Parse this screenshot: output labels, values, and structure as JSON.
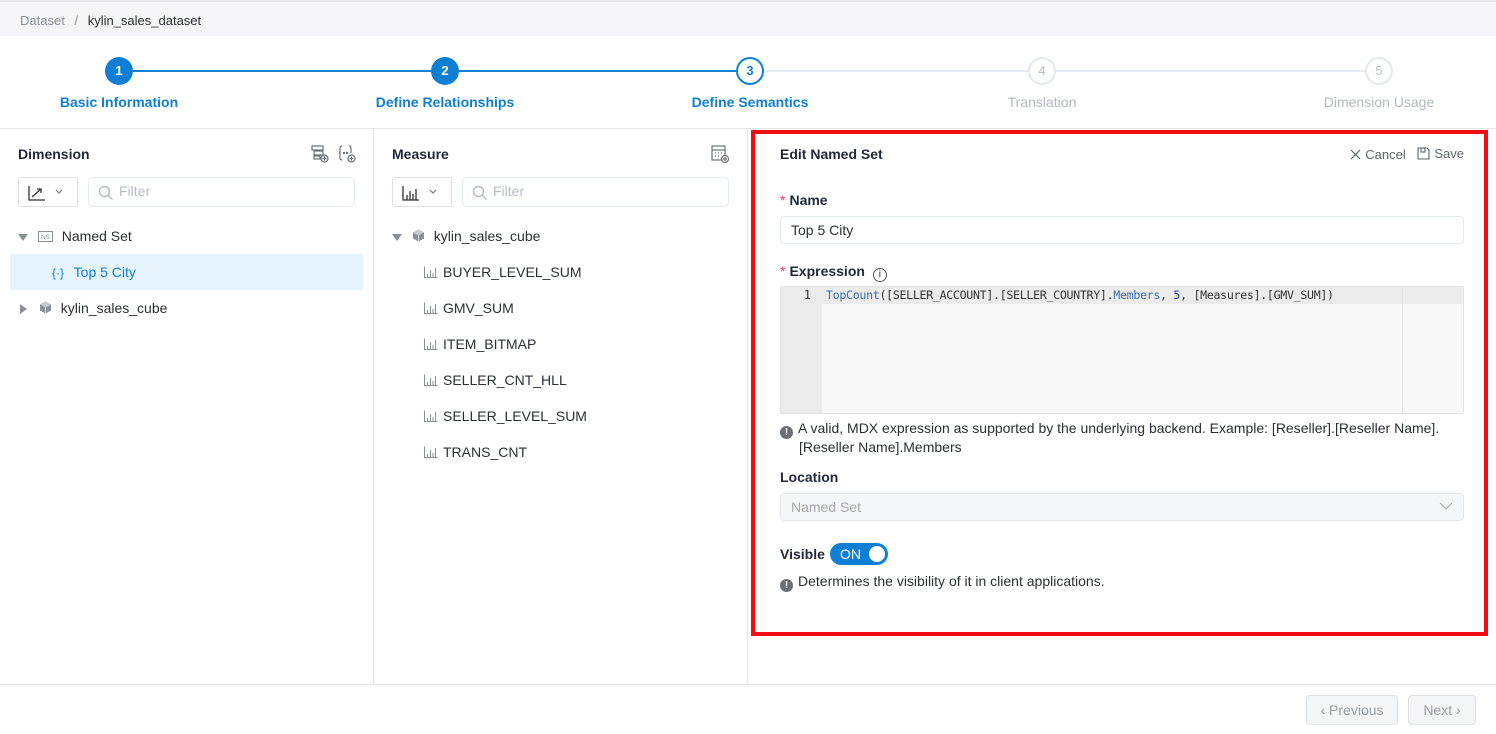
{
  "breadcrumb": {
    "root": "Dataset",
    "separator": "/",
    "current": "kylin_sales_dataset"
  },
  "steps": [
    {
      "number": "1",
      "label": "Basic Information",
      "state": "done"
    },
    {
      "number": "2",
      "label": "Define Relationships",
      "state": "done"
    },
    {
      "number": "3",
      "label": "Define Semantics",
      "state": "active"
    },
    {
      "number": "4",
      "label": "Translation",
      "state": "todo"
    },
    {
      "number": "5",
      "label": "Dimension Usage",
      "state": "todo"
    }
  ],
  "dimension_panel": {
    "title": "Dimension",
    "filter_placeholder": "Filter",
    "type_select_icon": "line-chart-icon",
    "actions": [
      "add-hierarchy-icon",
      "add-named-set-icon"
    ],
    "tree": [
      {
        "label": "Named Set",
        "icon": "named-set-icon",
        "expanded": true,
        "level": 0
      },
      {
        "label": "Top 5 City",
        "icon": "named-set-item-icon",
        "level": 1,
        "selected": true
      },
      {
        "label": "kylin_sales_cube",
        "icon": "cube-icon",
        "expanded": false,
        "level": 0
      }
    ]
  },
  "measure_panel": {
    "title": "Measure",
    "filter_placeholder": "Filter",
    "type_select_icon": "bar-chart-icon",
    "actions": [
      "add-calculated-measure-icon"
    ],
    "cube": {
      "label": "kylin_sales_cube",
      "expanded": true
    },
    "measures": [
      "BUYER_LEVEL_SUM",
      "GMV_SUM",
      "ITEM_BITMAP",
      "SELLER_CNT_HLL",
      "SELLER_LEVEL_SUM",
      "TRANS_CNT"
    ]
  },
  "edit_panel": {
    "title": "Edit Named Set",
    "cancel_label": "Cancel",
    "save_label": "Save",
    "name_label": "Name",
    "name_value": "Top 5 City",
    "expression_label": "Expression",
    "expression": {
      "line_number": "1",
      "fn": "TopCount",
      "part1": "([SELLER_ACCOUNT].[SELLER_COUNTRY].",
      "members": "Members",
      "part2": ", ",
      "count": "5",
      "part3": ", [Measures].[GMV_SUM])"
    },
    "expression_hint": "A valid, MDX expression as supported by the underlying backend. Example: [Reseller].[Reseller Name].",
    "expression_hint_2": "[Reseller Name].Members",
    "location_label": "Location",
    "location_value": "Named Set",
    "visible_label": "Visible",
    "visible_toggle": "ON",
    "visible_hint": "Determines the visibility of it in client applications."
  },
  "footer": {
    "previous_label": "Previous",
    "next_label": "Next"
  },
  "colors": {
    "primary": "#0f7fd6",
    "highlight_border": "#f20c14",
    "selected_row": "#e6f3fc"
  }
}
